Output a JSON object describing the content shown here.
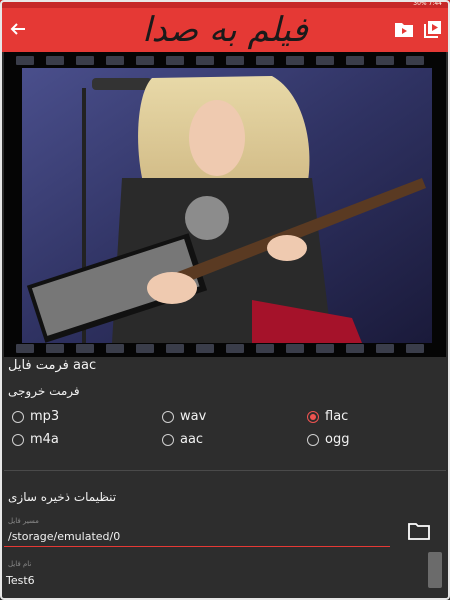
{
  "status_bar": {
    "text": "30% 7:44"
  },
  "app_bar": {
    "title": "فیلم به صدا",
    "back_icon": "arrow-left-icon",
    "icons": [
      "folder-video-icon",
      "video-library-icon"
    ]
  },
  "file_format": {
    "label": "فرمت فایل",
    "value": "aac"
  },
  "output_format": {
    "label": "فرمت خروجی",
    "options": [
      {
        "label": "mp3",
        "checked": false
      },
      {
        "label": "wav",
        "checked": false
      },
      {
        "label": "flac",
        "checked": true
      },
      {
        "label": "m4a",
        "checked": false
      },
      {
        "label": "aac",
        "checked": false
      },
      {
        "label": "ogg",
        "checked": false
      }
    ]
  },
  "save_settings": {
    "label": "تنظیمات ذخیره سازی",
    "path_caption": "مسیر فایل",
    "path_value": "/storage/emulated/0",
    "name_caption": "نام فایل",
    "name_value": "Test6"
  },
  "colors": {
    "accent": "#e53935",
    "background": "#2d2d2d"
  }
}
